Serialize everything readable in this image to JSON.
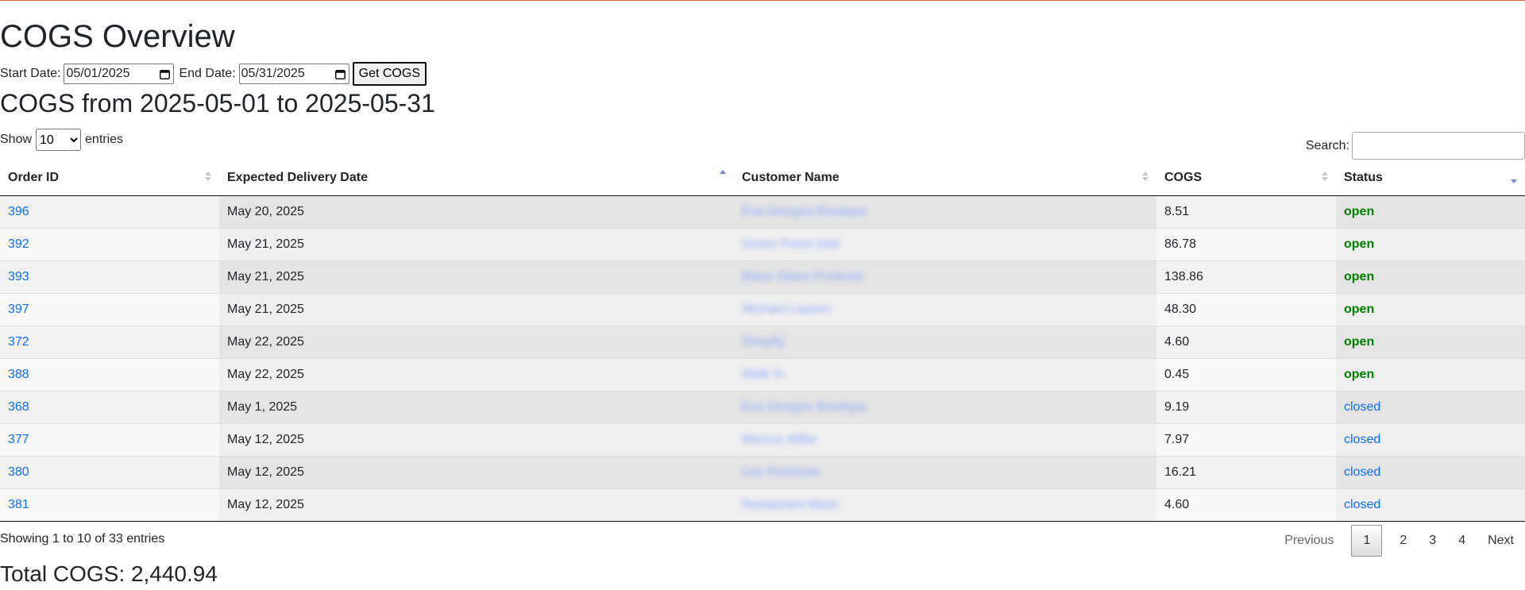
{
  "page": {
    "title": "COGS Overview",
    "subtitle": "COGS from 2025-05-01 to 2025-05-31",
    "total": "Total COGS: 2,440.94"
  },
  "filters": {
    "start_label": "Start Date:",
    "start_value": "05/01/2025",
    "end_label": "End Date:",
    "end_value": "05/31/2025",
    "submit_label": "Get COGS"
  },
  "controls": {
    "show_label": "Show",
    "entries_label": "entries",
    "page_size": "10",
    "search_label": "Search:",
    "search_value": ""
  },
  "table": {
    "headers": [
      "Order ID",
      "Expected Delivery Date",
      "Customer Name",
      "COGS",
      "Status"
    ],
    "sort_column": "Expected Delivery Date",
    "rows": [
      {
        "id": "396",
        "date": "May 20, 2025",
        "customer": "Eva Designs Boutique",
        "cogs": "8.51",
        "status": "open"
      },
      {
        "id": "392",
        "date": "May 21, 2025",
        "customer": "Green Fresh Deli",
        "cogs": "86.78",
        "status": "open"
      },
      {
        "id": "393",
        "date": "May 21, 2025",
        "customer": "Blaze Glass Products",
        "cogs": "138.86",
        "status": "open"
      },
      {
        "id": "397",
        "date": "May 21, 2025",
        "customer": "Michael Lassen",
        "cogs": "48.30",
        "status": "open"
      },
      {
        "id": "372",
        "date": "May 22, 2025",
        "customer": "Shopify",
        "cogs": "4.60",
        "status": "open"
      },
      {
        "id": "388",
        "date": "May 22, 2025",
        "customer": "Walk In",
        "cogs": "0.45",
        "status": "open"
      },
      {
        "id": "368",
        "date": "May 1, 2025",
        "customer": "Eva Designs Boutique",
        "cogs": "9.19",
        "status": "closed"
      },
      {
        "id": "377",
        "date": "May 12, 2025",
        "customer": "Marcus Miller",
        "cogs": "7.97",
        "status": "closed"
      },
      {
        "id": "380",
        "date": "May 12, 2025",
        "customer": "Lee Renshaw",
        "cogs": "16.21",
        "status": "closed"
      },
      {
        "id": "381",
        "date": "May 12, 2025",
        "customer": "Restaurant Maze",
        "cogs": "4.60",
        "status": "closed"
      }
    ]
  },
  "footer": {
    "info": "Showing 1 to 10 of 33 entries",
    "previous_label": "Previous",
    "next_label": "Next",
    "pages": [
      "1",
      "2",
      "3",
      "4"
    ],
    "current_page": "1"
  },
  "colors": {
    "accent_line": "#e0623a",
    "link": "#0d6efd",
    "open_status": "#008000"
  }
}
